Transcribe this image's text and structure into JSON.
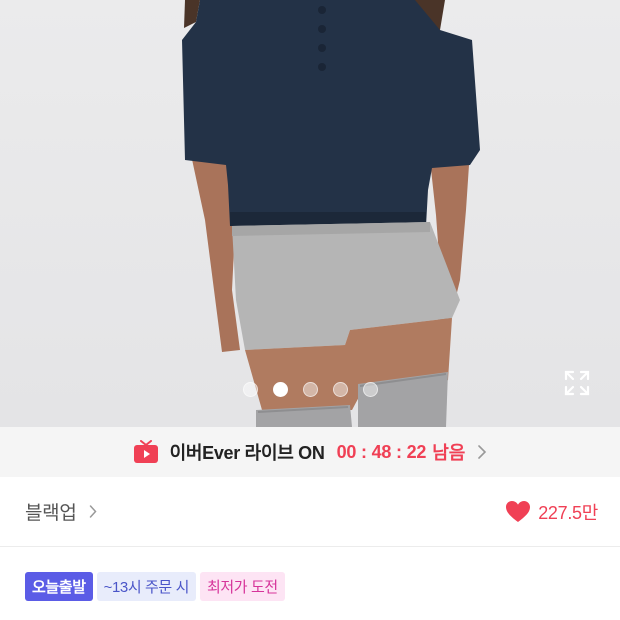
{
  "product": {
    "image_alt": "",
    "carousel": {
      "total": 5,
      "current": 2
    }
  },
  "live_banner": {
    "icon": "tv-live-icon",
    "title": "이버Ever 라이브 ON",
    "timer": "00 : 48 : 22",
    "remaining_label": "남음",
    "title_color": "#222222",
    "accent_color": "#f04055"
  },
  "brand": {
    "name": "블랙업"
  },
  "likes": {
    "icon": "heart-icon",
    "count": "227.5만",
    "color": "#f04055"
  },
  "badges": [
    {
      "label": "오늘출발",
      "style": "today"
    },
    {
      "label": "~13시 주문 시",
      "style": "cutoff"
    },
    {
      "label": "최저가 도전",
      "style": "lowest"
    }
  ],
  "title_preview": ""
}
